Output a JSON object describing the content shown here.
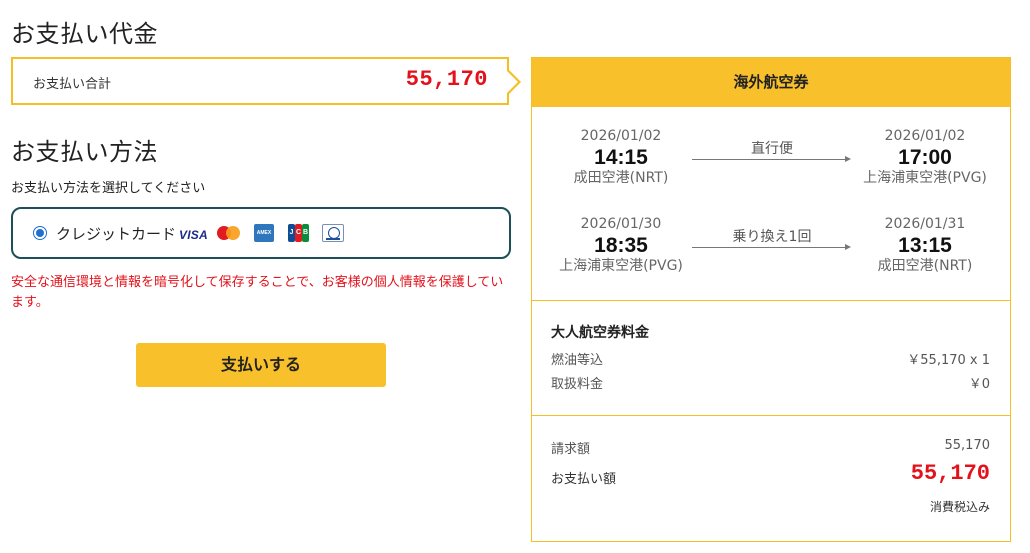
{
  "payment": {
    "title": "お支払い代金",
    "total_label": "お支払い合計",
    "total_amount": "55,170"
  },
  "method": {
    "title": "お支払い方法",
    "instruction": "お支払い方法を選択してください",
    "option_label": "クレジットカード",
    "cards": [
      "VISA",
      "Mastercard",
      "American Express",
      "JCB",
      "Diners Club"
    ],
    "security_note": "安全な通信環境と情報を暗号化して保存することで、お客様の個人情報を保護しています。",
    "pay_button": "支払いする"
  },
  "flight": {
    "header": "海外航空券",
    "segments": [
      {
        "dep_date": "2026/01/02",
        "dep_time": "14:15",
        "dep_airport": "成田空港(NRT)",
        "type": "直行便",
        "arr_date": "2026/01/02",
        "arr_time": "17:00",
        "arr_airport": "上海浦東空港(PVG)"
      },
      {
        "dep_date": "2026/01/30",
        "dep_time": "18:35",
        "dep_airport": "上海浦東空港(PVG)",
        "type": "乗り換え1回",
        "arr_date": "2026/01/31",
        "arr_time": "13:15",
        "arr_airport": "成田空港(NRT)"
      }
    ]
  },
  "fare": {
    "title": "大人航空券料金",
    "fuel_label": "燃油等込",
    "fuel_value": "￥55,170 x 1",
    "handling_label": "取扱料金",
    "handling_value": "￥0"
  },
  "summary": {
    "billing_label": "請求額",
    "billing_value": "55,170",
    "pay_label": "お支払い額",
    "pay_value": "55,170",
    "tax_note": "消費税込み"
  },
  "colors": {
    "accent": "#f8c12c",
    "price_red": "#e3111b",
    "method_border": "#1c4f58"
  }
}
